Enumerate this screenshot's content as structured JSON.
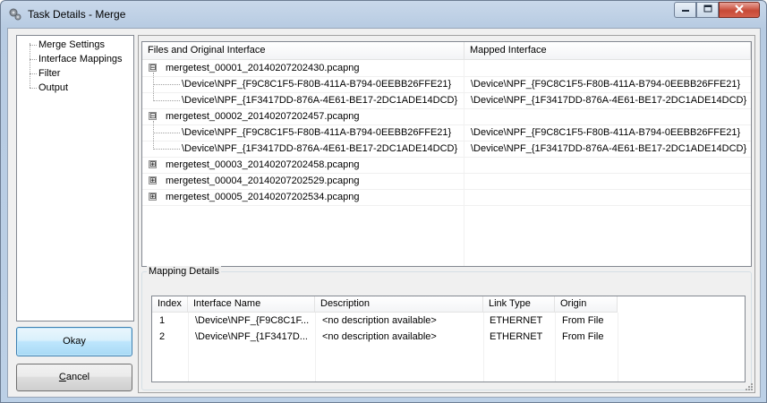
{
  "window": {
    "title": "Task Details - Merge",
    "icons": {
      "app": "gear-icon",
      "minimize": "minimize-icon",
      "maximize": "maximize-icon",
      "close": "close-icon"
    }
  },
  "nav": {
    "items": [
      {
        "label": "Merge Settings"
      },
      {
        "label": "Interface Mappings"
      },
      {
        "label": "Filter"
      },
      {
        "label": "Output"
      }
    ]
  },
  "buttons": {
    "ok": "Okay",
    "cancel": "Cancel"
  },
  "files_view": {
    "columns": [
      "Files and Original Interface",
      "Mapped Interface"
    ],
    "files": [
      {
        "name": "mergetest_00001_20140207202430.pcapng",
        "expanded": true,
        "expander": "⊟",
        "interfaces": [
          {
            "original": "\\Device\\NPF_{F9C8C1F5-F80B-411A-B794-0EEBB26FFE21}",
            "mapped": "\\Device\\NPF_{F9C8C1F5-F80B-411A-B794-0EEBB26FFE21}"
          },
          {
            "original": "\\Device\\NPF_{1F3417DD-876A-4E61-BE17-2DC1ADE14DCD}",
            "mapped": "\\Device\\NPF_{1F3417DD-876A-4E61-BE17-2DC1ADE14DCD}"
          }
        ]
      },
      {
        "name": "mergetest_00002_20140207202457.pcapng",
        "expanded": true,
        "expander": "⊟",
        "interfaces": [
          {
            "original": "\\Device\\NPF_{F9C8C1F5-F80B-411A-B794-0EEBB26FFE21}",
            "mapped": "\\Device\\NPF_{F9C8C1F5-F80B-411A-B794-0EEBB26FFE21}"
          },
          {
            "original": "\\Device\\NPF_{1F3417DD-876A-4E61-BE17-2DC1ADE14DCD}",
            "mapped": "\\Device\\NPF_{1F3417DD-876A-4E61-BE17-2DC1ADE14DCD}"
          }
        ]
      },
      {
        "name": "mergetest_00003_20140207202458.pcapng",
        "expanded": false,
        "expander": "⊞",
        "interfaces": []
      },
      {
        "name": "mergetest_00004_20140207202529.pcapng",
        "expanded": false,
        "expander": "⊞",
        "interfaces": []
      },
      {
        "name": "mergetest_00005_20140207202534.pcapng",
        "expanded": false,
        "expander": "⊞",
        "interfaces": []
      }
    ]
  },
  "mapping_details": {
    "title": "Mapping Details",
    "columns": [
      "Index",
      "Interface Name",
      "Description",
      "Link Type",
      "Origin"
    ],
    "rows": [
      {
        "index": "1",
        "interface_name": "\\Device\\NPF_{F9C8C1F...",
        "description": "<no description available>",
        "link_type": "ETHERNET",
        "origin": "From File"
      },
      {
        "index": "2",
        "interface_name": "\\Device\\NPF_{1F3417D...",
        "description": "<no description available>",
        "link_type": "ETHERNET",
        "origin": "From File"
      }
    ]
  }
}
